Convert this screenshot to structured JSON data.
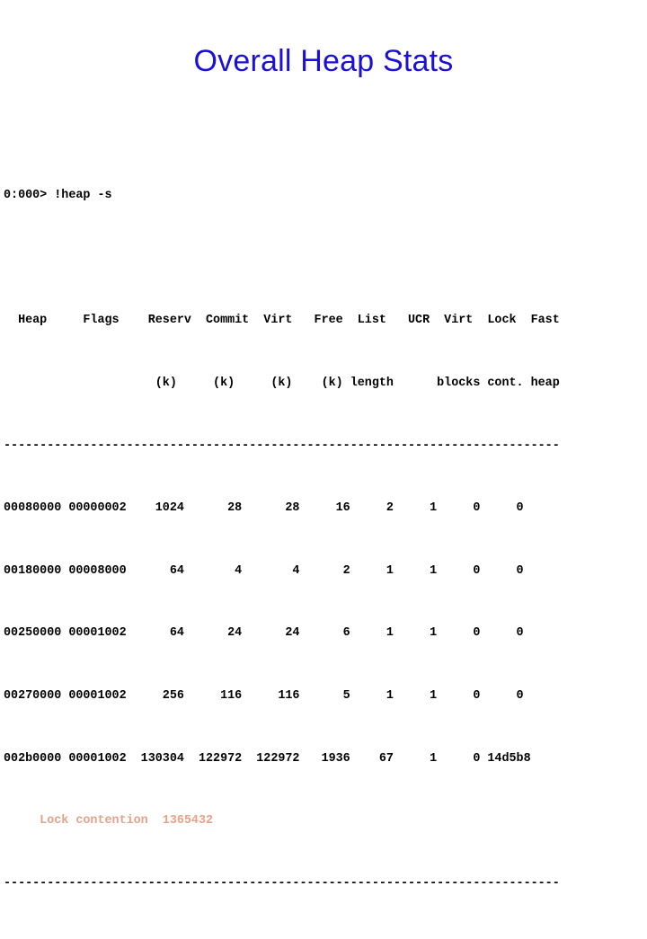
{
  "slide": {
    "title": "Overall Heap Stats",
    "title_color": "#1a10d8",
    "background_color": "#ffffff"
  },
  "console": {
    "text_color": "#000000",
    "highlight_color": "#e8a188",
    "prompt": "0:000> !heap -s",
    "blank_after_prompt": "",
    "header_row_1": "  Heap     Flags    Reserv  Commit  Virt   Free  List   UCR  Virt  Lock  Fast ",
    "header_row_2": "                     (k)     (k)     (k)    (k) length      blocks cont. heap ",
    "separator_top": "-----------------------------------------------------------------------------",
    "separator_bottom": "-----------------------------------------------------------------------------",
    "rows": [
      {
        "heap": "00080000",
        "flags": "00000002",
        "reserv_k": "1024",
        "commit_k": "28",
        "virt_k": "28",
        "free_k": "16",
        "list_length": "2",
        "ucr": "1",
        "virt_blocks": "0",
        "lock_cont": "0",
        "fast_heap": ""
      },
      {
        "heap": "00180000",
        "flags": "00008000",
        "reserv_k": "64",
        "commit_k": "4",
        "virt_k": "4",
        "free_k": "2",
        "list_length": "1",
        "ucr": "1",
        "virt_blocks": "0",
        "lock_cont": "0",
        "fast_heap": ""
      },
      {
        "heap": "00250000",
        "flags": "00001002",
        "reserv_k": "64",
        "commit_k": "24",
        "virt_k": "24",
        "free_k": "6",
        "list_length": "1",
        "ucr": "1",
        "virt_blocks": "0",
        "lock_cont": "0",
        "fast_heap": ""
      },
      {
        "heap": "00270000",
        "flags": "00001002",
        "reserv_k": "256",
        "commit_k": "116",
        "virt_k": "116",
        "free_k": "5",
        "list_length": "1",
        "ucr": "1",
        "virt_blocks": "0",
        "lock_cont": "0",
        "fast_heap": ""
      },
      {
        "heap": "002b0000",
        "flags": "00001002",
        "reserv_k": "130304",
        "commit_k": "122972",
        "virt_k": "122972",
        "free_k": "1936",
        "list_length": "67",
        "ucr": "1",
        "virt_blocks": "0",
        "lock_cont": "14d5b8",
        "fast_heap": ""
      }
    ],
    "row_lines": [
      "00080000 00000002    1024      28      28     16     2     1     0     0",
      "00180000 00008000      64       4       4      2     1     1     0     0",
      "00250000 00001002      64      24      24      6     1     1     0     0",
      "00270000 00001002     256     116     116      5     1     1     0     0",
      "002b0000 00001002  130304  122972  122972   1936    67     1     0 14d5b8"
    ],
    "lock_contention_line": "     Lock contention  1365432",
    "lock_contention_label": "Lock contention",
    "lock_contention_value": "1365432",
    "columns": [
      "Heap",
      "Flags",
      "Reserv (k)",
      "Commit (k)",
      "Virt (k)",
      "Free (k)",
      "List length",
      "UCR",
      "Virt blocks",
      "Lock cont.",
      "Fast heap"
    ]
  }
}
